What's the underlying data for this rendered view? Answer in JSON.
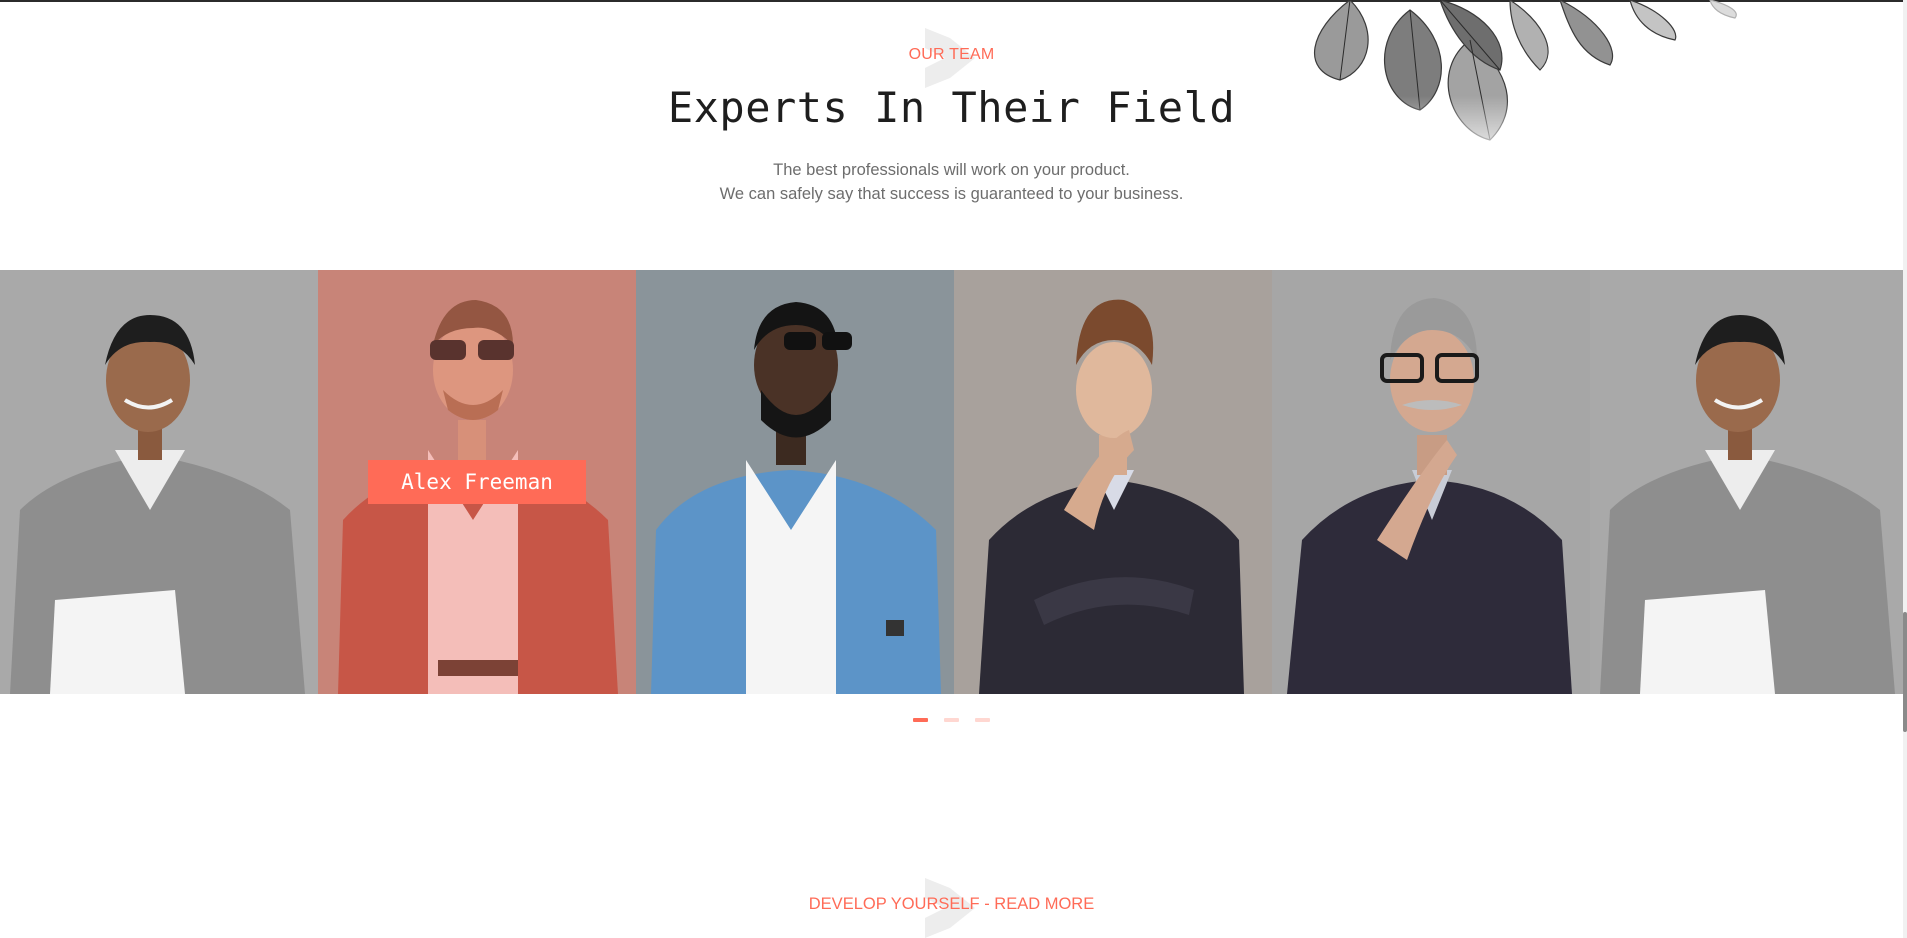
{
  "section": {
    "eyebrow": "OUR TEAM",
    "title": "Experts In Their Field",
    "lead_line_1": "The best professionals will work on your product.",
    "lead_line_2": "We can safely say that success is guaranteed to your business."
  },
  "team": {
    "members": [
      {
        "name": "",
        "photo": "man-gray-shirt-laptop"
      },
      {
        "name": "Alex Freeman",
        "photo": "man-sunglasses-plaid-shirt"
      },
      {
        "name": "",
        "photo": "man-blue-check-shirt"
      },
      {
        "name": "",
        "photo": "man-dark-suit-thinking"
      },
      {
        "name": "",
        "photo": "older-man-suit-glasses"
      },
      {
        "name": "",
        "photo": "man-gray-shirt-laptop"
      }
    ],
    "active_index": 1,
    "pagination": [
      "page-1",
      "page-2",
      "page-3"
    ],
    "active_page": 0
  },
  "next_section": {
    "eyebrow": "DEVELOP YOURSELF - READ MORE"
  },
  "colors": {
    "accent": "#ff6b57",
    "heading": "#1e1e1e",
    "body_text": "#6d6d6d"
  }
}
